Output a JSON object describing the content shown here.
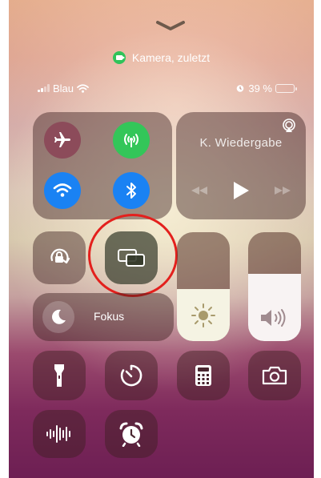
{
  "recent_activity": {
    "label": "Kamera, zuletzt"
  },
  "status_bar": {
    "carrier": "Blau",
    "battery_text": "39 %",
    "battery_level": 0.39
  },
  "media": {
    "title": "K. Wiedergabe"
  },
  "focus": {
    "label": "Fokus"
  },
  "sliders": {
    "brightness_level": 0.48,
    "volume_level": 0.62
  },
  "colors": {
    "cellular_active": "#33c659",
    "wifi_active": "#1a82f3",
    "bluetooth_active": "#1a82f3",
    "airplane_inactive": "#8c4b5a",
    "annotation_ring": "#e3201d"
  },
  "icons": [
    "chevron-down-icon",
    "camera-icon",
    "signal-icon",
    "wifi-icon",
    "alarm-icon",
    "battery-icon",
    "airplane-icon",
    "cellular-icon",
    "bluetooth-icon",
    "airplay-icon",
    "rewind-icon",
    "play-icon",
    "forward-icon",
    "rotation-lock-icon",
    "screen-mirroring-icon",
    "moon-icon",
    "sun-icon",
    "speaker-icon",
    "flashlight-icon",
    "timer-icon",
    "calculator-icon",
    "camera-icon",
    "sound-recognition-icon",
    "alarm-clock-icon"
  ]
}
